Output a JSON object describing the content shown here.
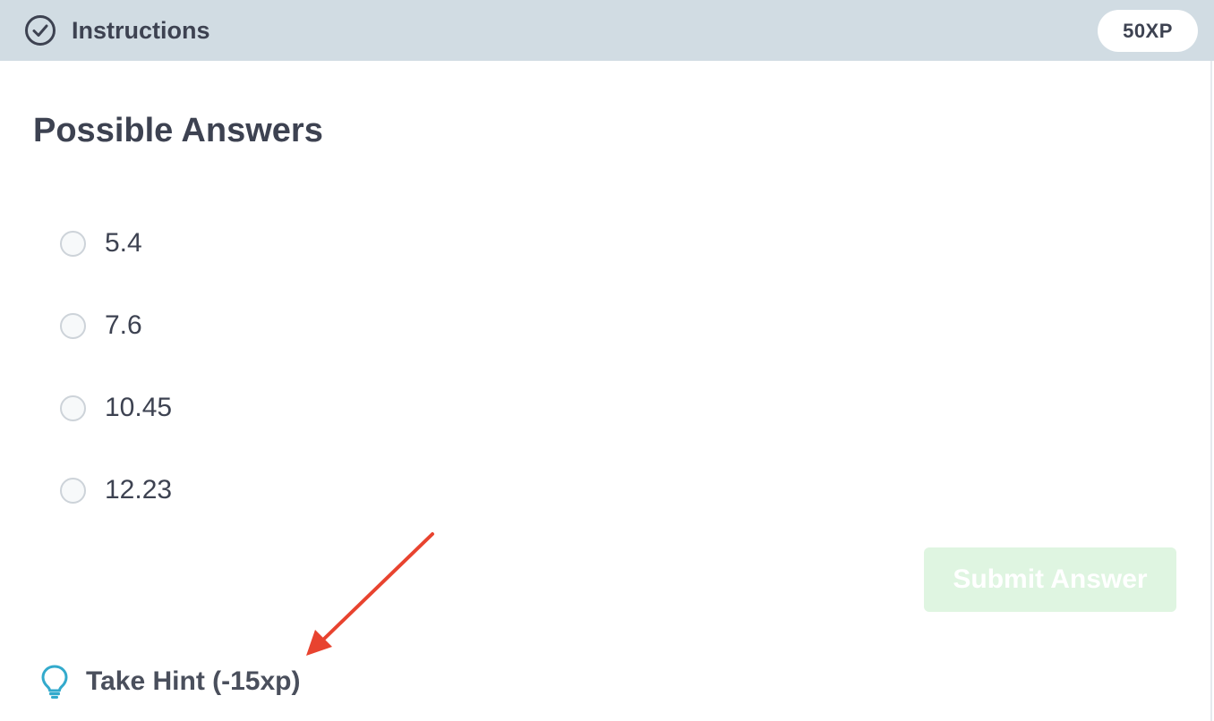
{
  "header": {
    "title": "Instructions",
    "xp_badge": "50XP",
    "icon": "check-circle-icon"
  },
  "main": {
    "section_title": "Possible Answers",
    "options": [
      {
        "label": "5.4",
        "selected": false
      },
      {
        "label": "7.6",
        "selected": false
      },
      {
        "label": "10.45",
        "selected": false
      },
      {
        "label": "12.23",
        "selected": false
      }
    ],
    "submit_label": "Submit Answer",
    "submit_enabled": false
  },
  "hint": {
    "label": "Take Hint (-15xp)",
    "icon": "lightbulb-icon"
  },
  "colors": {
    "header_bg": "#d1dce3",
    "text": "#3d4251",
    "submit_bg_disabled": "#dff5e1",
    "hint_icon": "#33aacc",
    "annotation_arrow": "#e8432f"
  }
}
